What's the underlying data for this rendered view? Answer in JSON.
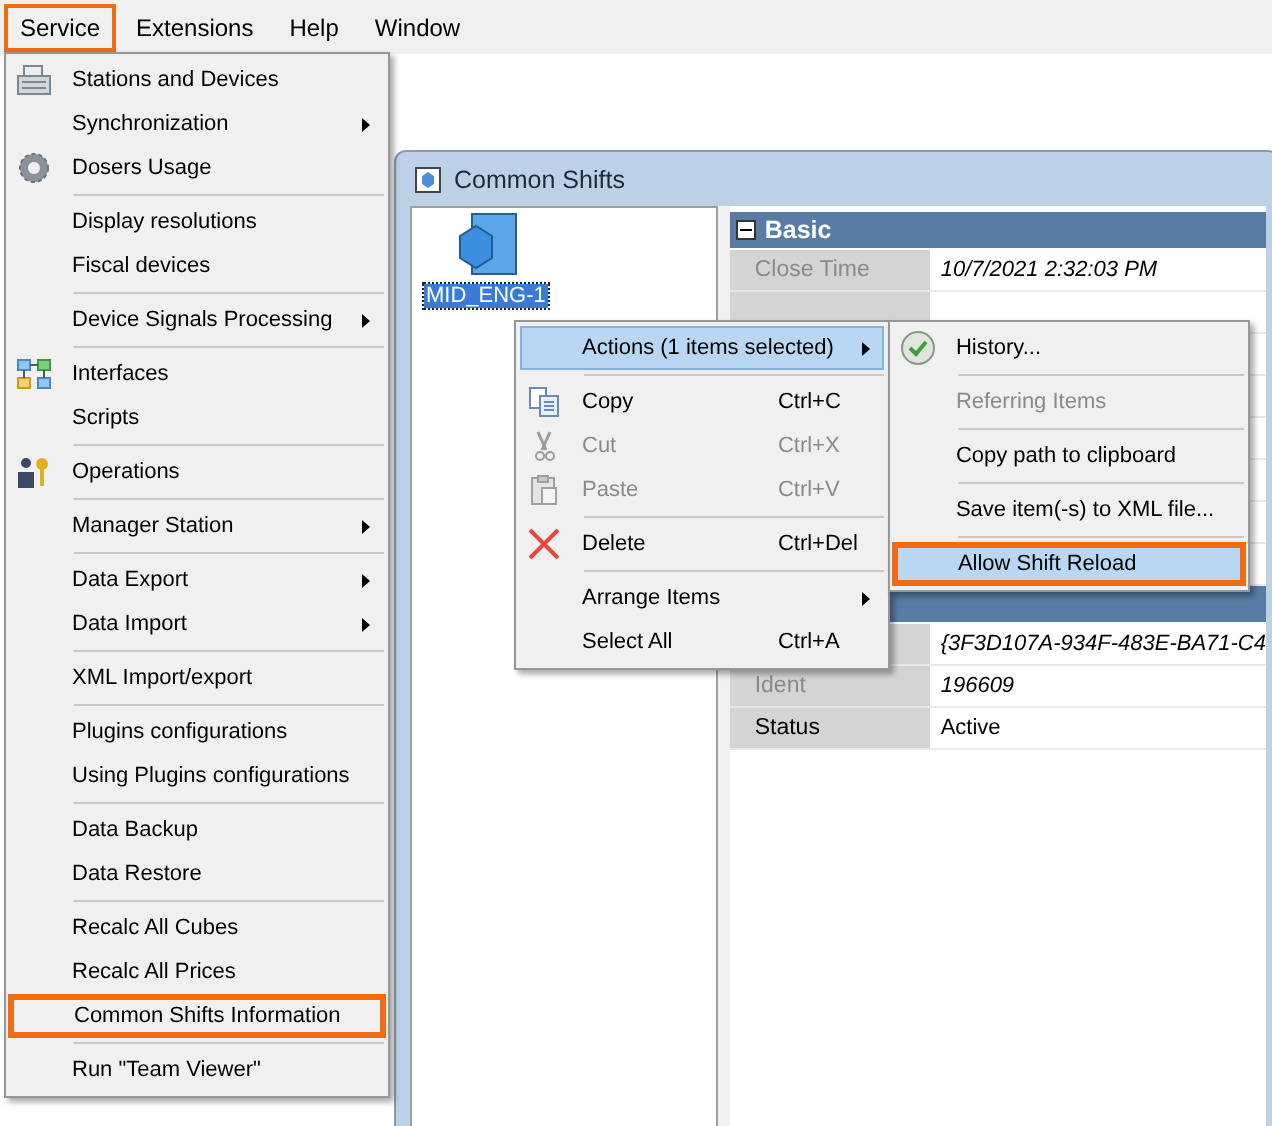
{
  "menu_bar": [
    {
      "label": "Service",
      "outlined": true
    },
    {
      "label": "Extensions",
      "outlined": false
    },
    {
      "label": "Help",
      "outlined": false
    },
    {
      "label": "Window",
      "outlined": false
    }
  ],
  "service_menu": [
    [
      {
        "label": "Stations and Devices",
        "kind": "register",
        "has_submenu": false,
        "outlined": false
      },
      {
        "label": "Synchronization",
        "kind": "plain",
        "has_submenu": true,
        "outlined": false
      },
      {
        "label": "Dosers Usage",
        "kind": "gear",
        "has_submenu": false,
        "outlined": false
      }
    ],
    [
      {
        "label": "Display resolutions",
        "kind": "plain",
        "has_submenu": false,
        "outlined": false
      },
      {
        "label": "Fiscal devices",
        "kind": "plain",
        "has_submenu": false,
        "outlined": false
      }
    ],
    [
      {
        "label": "Device Signals Processing",
        "kind": "plain",
        "has_submenu": true,
        "outlined": false
      }
    ],
    [
      {
        "label": "Interfaces",
        "kind": "blocks",
        "has_submenu": false,
        "outlined": false
      },
      {
        "label": "Scripts",
        "kind": "plain",
        "has_submenu": false,
        "outlined": false
      }
    ],
    [
      {
        "label": "Operations",
        "kind": "person",
        "has_submenu": false,
        "outlined": false
      }
    ],
    [
      {
        "label": "Manager Station",
        "kind": "plain",
        "has_submenu": true,
        "outlined": false
      }
    ],
    [
      {
        "label": "Data Export",
        "kind": "plain",
        "has_submenu": true,
        "outlined": false
      },
      {
        "label": "Data Import",
        "kind": "plain",
        "has_submenu": true,
        "outlined": false
      }
    ],
    [
      {
        "label": "XML Import/export",
        "kind": "plain",
        "has_submenu": false,
        "outlined": false
      }
    ],
    [
      {
        "label": "Plugins configurations",
        "kind": "plain",
        "has_submenu": false,
        "outlined": false
      },
      {
        "label": "Using Plugins configurations",
        "kind": "plain",
        "has_submenu": false,
        "outlined": false
      }
    ],
    [
      {
        "label": "Data Backup",
        "kind": "plain",
        "has_submenu": false,
        "outlined": false
      },
      {
        "label": "Data Restore",
        "kind": "plain",
        "has_submenu": false,
        "outlined": false
      }
    ],
    [
      {
        "label": "Recalc All Cubes",
        "kind": "plain",
        "has_submenu": false,
        "outlined": false
      },
      {
        "label": "Recalc All Prices",
        "kind": "plain",
        "has_submenu": false,
        "outlined": false
      },
      {
        "label": "Common Shifts Information",
        "kind": "plain",
        "has_submenu": false,
        "outlined": true
      }
    ],
    [
      {
        "label": "Run \"Team Viewer\"",
        "kind": "plain",
        "has_submenu": false,
        "outlined": false
      }
    ]
  ],
  "window": {
    "title": "Common Shifts",
    "items": [
      {
        "label": "MID_ENG-1",
        "selected": true
      }
    ],
    "property_grid": [
      {
        "title": "Basic",
        "rows": [
          {
            "kind": "property",
            "label": "Close Time",
            "value": "10/7/2021 2:32:03 PM",
            "readonly": true
          },
          {
            "kind": "covered"
          },
          {
            "kind": "covered"
          },
          {
            "kind": "covered"
          },
          {
            "kind": "covered"
          },
          {
            "kind": "covered"
          },
          {
            "kind": "covered"
          },
          {
            "kind": "covered"
          }
        ]
      },
      {
        "rows": [
          {
            "kind": "property",
            "value": "{3F3D107A-934F-483E-BA71-C4",
            "readonly": true
          },
          {
            "kind": "property",
            "label": "Ident",
            "value": "196609",
            "readonly": true
          },
          {
            "kind": "property",
            "label": "Status",
            "value": "Active",
            "readonly": false
          }
        ]
      }
    ]
  },
  "context_menu": [
    [
      {
        "label": "Actions (1 items selected)",
        "kind": "plain",
        "has_submenu": true,
        "disabled": false,
        "selected": true
      }
    ],
    [
      {
        "label": "Copy",
        "kind": "copy",
        "shortcut": "Ctrl+C",
        "has_submenu": false,
        "disabled": false,
        "selected": false
      },
      {
        "label": "Cut",
        "kind": "scissors",
        "shortcut": "Ctrl+X",
        "has_submenu": false,
        "disabled": true,
        "selected": false
      },
      {
        "label": "Paste",
        "kind": "clipboard",
        "shortcut": "Ctrl+V",
        "has_submenu": false,
        "disabled": true,
        "selected": false
      }
    ],
    [
      {
        "label": "Delete",
        "kind": "cross",
        "shortcut": "Ctrl+Del",
        "has_submenu": false,
        "disabled": false,
        "selected": false
      }
    ],
    [
      {
        "label": "Arrange Items",
        "kind": "plain",
        "has_submenu": true,
        "disabled": false,
        "selected": false
      },
      {
        "label": "Select All",
        "kind": "plain",
        "shortcut": "Ctrl+A",
        "has_submenu": false,
        "disabled": false,
        "selected": false
      }
    ]
  ],
  "actions_submenu": [
    {
      "label": "History...",
      "kind": "history",
      "disabled": false,
      "selected": false,
      "outlined": false
    },
    {
      "label": "Referring Items",
      "kind": "plain",
      "disabled": true,
      "selected": false,
      "outlined": false
    },
    {
      "label": "Copy path to clipboard",
      "kind": "plain",
      "disabled": false,
      "selected": false,
      "outlined": false
    },
    {
      "label": "Save item(-s) to XML file...",
      "kind": "plain",
      "disabled": false,
      "selected": false,
      "outlined": false
    },
    {
      "label": "Allow Shift Reload",
      "kind": "plain",
      "disabled": false,
      "selected": true,
      "outlined": true
    }
  ]
}
